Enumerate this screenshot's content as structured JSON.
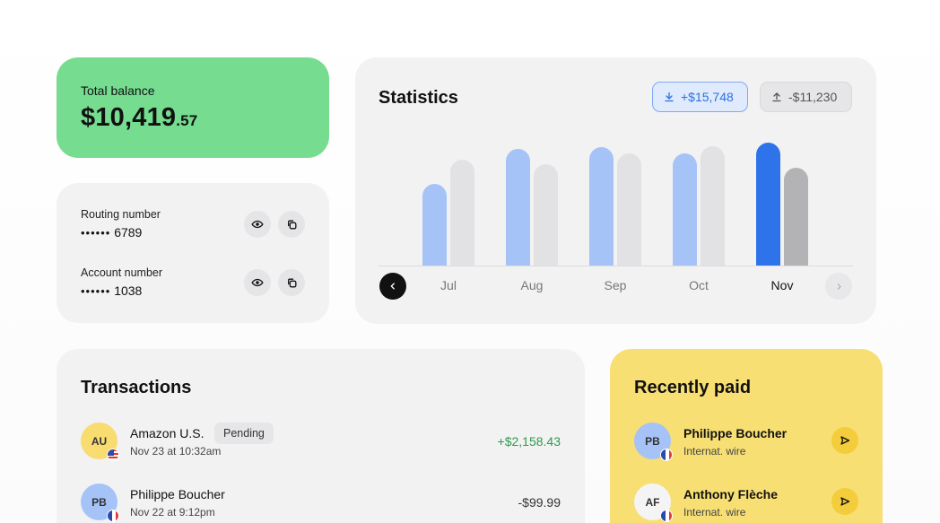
{
  "balance": {
    "label": "Total balance",
    "amount_main": "$10,419",
    "amount_cents": ".57"
  },
  "bank": {
    "routing": {
      "label": "Routing number",
      "masked": "••••••",
      "last4": "6789"
    },
    "account": {
      "label": "Account number",
      "masked": "••••••",
      "last4": "1038"
    }
  },
  "statistics": {
    "title": "Statistics",
    "income_pill": "+$15,748",
    "expense_pill": "-$11,230",
    "selected_month": "Nov"
  },
  "chart_data": {
    "type": "bar",
    "categories": [
      "Jul",
      "Aug",
      "Sep",
      "Oct",
      "Nov"
    ],
    "series": [
      {
        "values": [
          91,
          130,
          132,
          125,
          137
        ]
      },
      {
        "values": [
          118,
          113,
          125,
          133,
          109
        ]
      }
    ],
    "ylim": [
      0,
      150
    ],
    "grid": false,
    "colors": {
      "income": "#a6c3f8",
      "expense": "#e2e2e4",
      "income_active": "#2f73ea",
      "expense_active": "#b3b3b5"
    }
  },
  "transactions": {
    "title": "Transactions",
    "items": [
      {
        "initials": "AU",
        "name": "Amazon U.S.",
        "badge": "Pending",
        "date": "Nov 23 at 10:32am",
        "amount": "+$2,158.43",
        "avatar_color": "#f8dc70",
        "flag": "us"
      },
      {
        "initials": "PB",
        "name": "Philippe Boucher",
        "date": "Nov 22 at 9:12pm",
        "amount": "-$99.99",
        "avatar_color": "#a6c3f8",
        "flag": "fr"
      }
    ]
  },
  "recently_paid": {
    "title": "Recently paid",
    "items": [
      {
        "initials": "PB",
        "name": "Philippe Boucher",
        "sub": "Internat. wire",
        "avatar_color": "#a6c3f8",
        "flag": "fr"
      },
      {
        "initials": "AF",
        "name": "Anthony Flèche",
        "sub": "Internat. wire",
        "avatar_color": "#f3f3f3",
        "flag": "fr"
      }
    ]
  }
}
